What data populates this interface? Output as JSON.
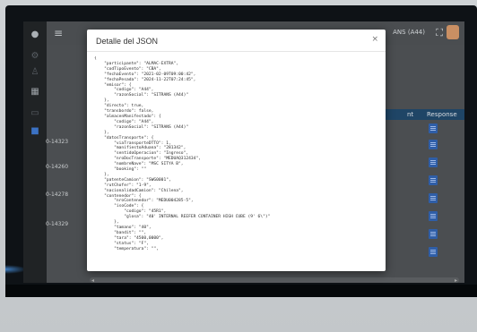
{
  "topbar": {
    "user_label": "ANS (A44)"
  },
  "table": {
    "response_header": "Response",
    "nt_header": "nt",
    "row_ids": [
      "0-14323",
      "0-14260",
      "0-14278",
      "0-14329"
    ]
  },
  "modal": {
    "title": "Detalle del JSON",
    "close_label": "×",
    "json_text": "{\n    \"participante\": \"ALMAC-EXTRA\",\n    \"codTipoEvento\": \"CBA\",\n    \"fechaEvento\": \"2021-02-09T09:00:42\",\n    \"fechaPesada\": \"2024-11-22T07:24:45\",\n    \"emisor\": {\n        \"codigo\": \"A44\",\n        \"razonSocial\": \"SITRANS (A44)\"\n    },\n    \"directo\": true,\n    \"transbordo\": false,\n    \"almacenManifestado\": {\n        \"codigo\": \"A44\",\n        \"razonSocial\": \"SITRANS (A44)\"\n    },\n    \"datosTransporte\": {\n        \"viaTransporteDTTO\": 1,\n        \"manifiestoAduana\": \"281342\",\n        \"sentidoOperacion\": \"Ingreso\",\n        \"nroDocTransporte\": \"MEDUAQ312434\",\n        \"nombreNave\": \"MSC SITYA B\",\n        \"booking\": \"\"\n    },\n    \"patenteCamion\": \"SWG0001\",\n    \"rutChofer\": \"1-9\",\n    \"nacionalidadCamion\": \"Chilena\",\n    \"contenedor\": {\n        \"nroContenedor\": \"MEDU004285-5\",\n        \"isoCode\": {\n            \"codigo\": \"45R1\",\n            \"glosa\": \"40' INTERNAL REEFER CONTAINER HIGH CUBE (9' 6\\\")\"\n        },\n        \"tamano\": \"40\",\n        \"bandit\": \"\",\n        \"tara\": \"4500,0000\",\n        \"status\": \"F\",\n        \"temperatura\": \"\","
  }
}
